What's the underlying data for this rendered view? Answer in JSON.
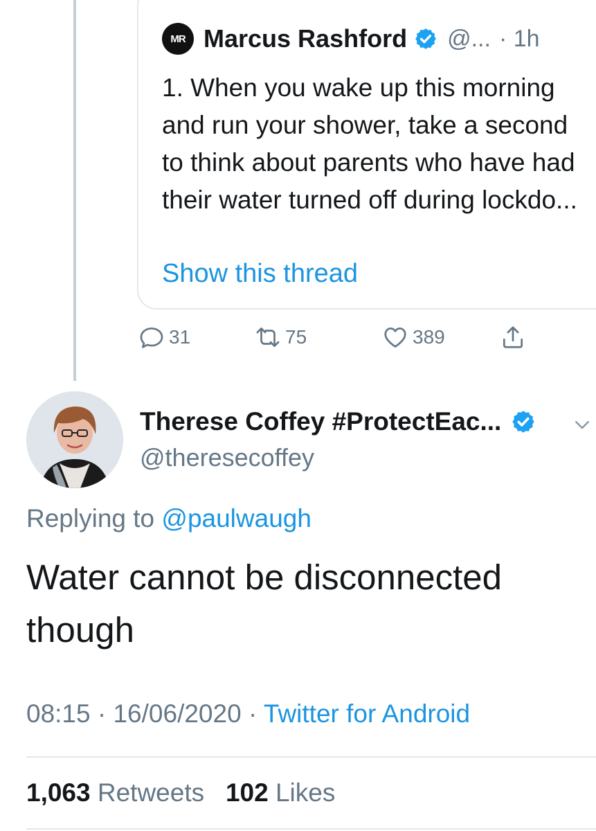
{
  "quoted_tweet": {
    "logo_text": "MR",
    "author_name": "Marcus Rashford",
    "handle": "@...",
    "time": "· 1h",
    "text": "1. When you wake up this morning and run your shower, take a second to think about parents who have had their water turned off during lockdo...",
    "thread_link": "Show this thread"
  },
  "actions": {
    "replies": "31",
    "retweets": "75",
    "likes": "389"
  },
  "tweet": {
    "author_name": "Therese Coffey #ProtectEac...",
    "handle": "@theresecoffey",
    "replying_prefix": "Replying to",
    "replying_to": "@paulwaugh",
    "text": "Water cannot be disconnected though",
    "time": "08:15",
    "date": "16/06/2020",
    "source": "Twitter for Android",
    "retweet_count": "1,063",
    "retweet_label": "Retweets",
    "like_count": "102",
    "like_label": "Likes"
  },
  "colors": {
    "accent": "#1b95e0",
    "muted": "#657786",
    "text": "#14171a",
    "border": "#e1e8ed",
    "verified": "#1da1f2"
  }
}
